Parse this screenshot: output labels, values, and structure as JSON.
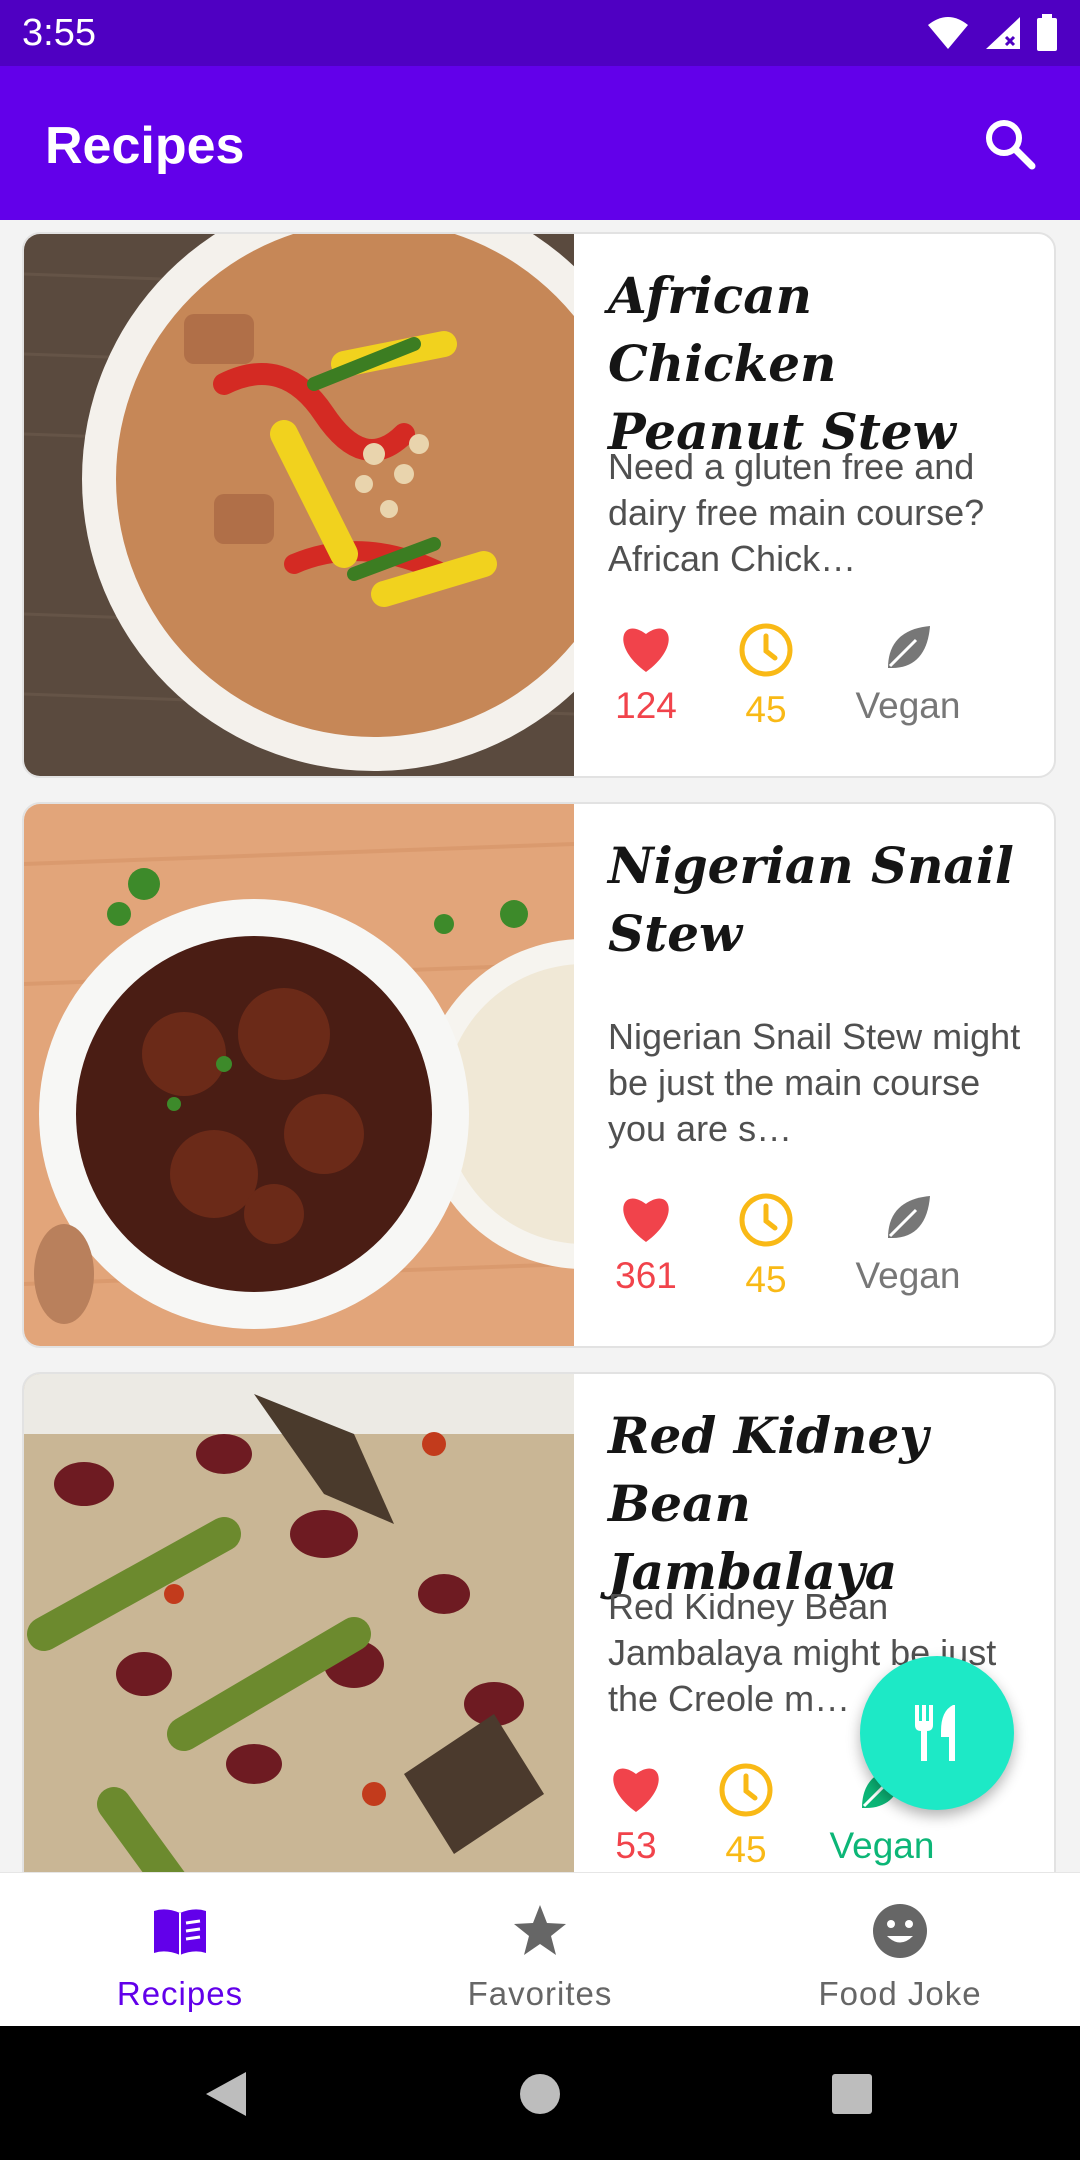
{
  "status_bar": {
    "time": "3:55"
  },
  "app_bar": {
    "title": "Recipes"
  },
  "recipes": [
    {
      "title": "African Chicken Peanut Stew",
      "description": "Need a gluten free and dairy free main course? African Chick…",
      "likes": "124",
      "minutes": "45",
      "vegan_label": "Vegan",
      "vegan": false
    },
    {
      "title": "Nigerian Snail Stew",
      "description": "Nigerian Snail Stew might be just the main course you are s…",
      "likes": "361",
      "minutes": "45",
      "vegan_label": "Vegan",
      "vegan": false
    },
    {
      "title": "Red Kidney Bean Jambalaya",
      "description": "Red Kidney Bean Jambalaya might be just the Creole m…",
      "likes": "53",
      "minutes": "45",
      "vegan_label": "Vegan",
      "vegan": true
    }
  ],
  "bottom_nav": [
    {
      "label": "Recipes",
      "icon": "book-icon",
      "active": true
    },
    {
      "label": "Favorites",
      "icon": "star-icon",
      "active": false
    },
    {
      "label": "Food Joke",
      "icon": "smiley-icon",
      "active": false
    }
  ],
  "colors": {
    "primary": "#6200ea",
    "status_bar": "#4f00c2",
    "fab": "#1de9c6",
    "heart": "#f1434b",
    "clock": "#f9b916",
    "vegan_active": "#0cb677",
    "inactive": "#777777"
  }
}
